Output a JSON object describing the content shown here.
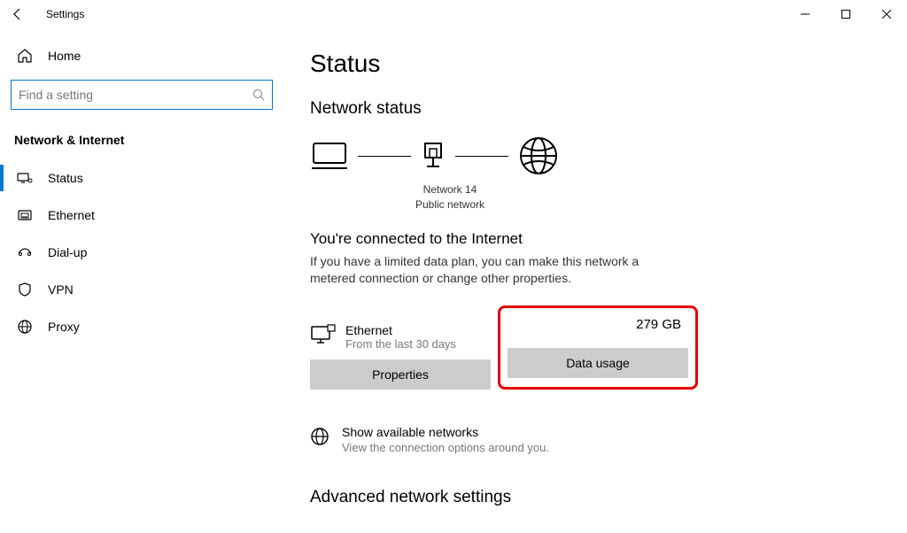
{
  "window": {
    "title": "Settings"
  },
  "sidebar": {
    "home": "Home",
    "search_placeholder": "Find a setting",
    "section": "Network & Internet",
    "items": [
      {
        "label": "Status"
      },
      {
        "label": "Ethernet"
      },
      {
        "label": "Dial-up"
      },
      {
        "label": "VPN"
      },
      {
        "label": "Proxy"
      }
    ]
  },
  "content": {
    "title": "Status",
    "network_status": "Network status",
    "device_name": "Network 14",
    "device_type": "Public network",
    "connected_title": "You're connected to the Internet",
    "connected_desc": "If you have a limited data plan, you can make this network a metered connection or change other properties.",
    "ethernet": {
      "name": "Ethernet",
      "period": "From the last 30 days",
      "usage": "279 GB"
    },
    "buttons": {
      "properties": "Properties",
      "data_usage": "Data usage"
    },
    "available": {
      "title": "Show available networks",
      "desc": "View the connection options around you."
    },
    "advanced": "Advanced network settings"
  }
}
